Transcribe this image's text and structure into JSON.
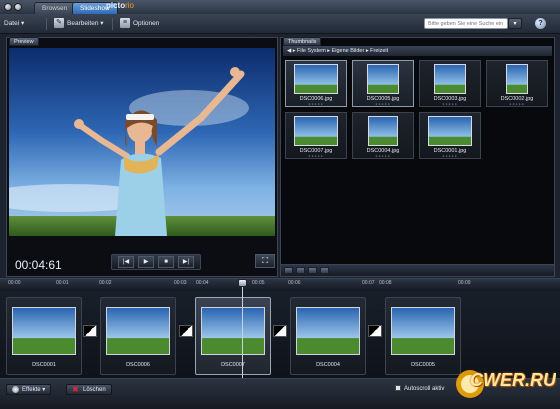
{
  "app": {
    "tabs": [
      {
        "label": "Browsen",
        "active": false
      },
      {
        "label": "Slideshow",
        "active": true
      }
    ],
    "brand": "picto",
    "brand_suffix": "rio"
  },
  "toolbar": {
    "file_label": "Datei",
    "edit_label": "Bearbeiten",
    "options_label": "Optionen",
    "search_placeholder": "Bitte geben Sie eine Suche ein",
    "help_label": "?"
  },
  "preview": {
    "tab_label": "Preview",
    "timecode": "00:04:61",
    "controls": [
      "prev-icon",
      "play-icon",
      "stop-icon",
      "next-icon"
    ]
  },
  "thumbnails": {
    "tab_label": "Thumbnails",
    "breadcrumb": [
      "File System",
      "Eigene Bilder",
      "Freizeit"
    ],
    "items": [
      {
        "label": "DSC0006.jpg",
        "selected": true
      },
      {
        "label": "DSC0005.jpg",
        "selected": true
      },
      {
        "label": "DSC0003.jpg",
        "selected": false
      },
      {
        "label": "DSC0002.jpg",
        "selected": false
      },
      {
        "label": "DSC0007.jpg",
        "selected": false
      },
      {
        "label": "DSC0004.jpg",
        "selected": false
      },
      {
        "label": "DSC0001.jpg",
        "selected": false
      }
    ]
  },
  "timeline": {
    "ruler_ticks": [
      "00:00",
      "00:01",
      "00:02",
      "00:03",
      "00:04",
      "00:05",
      "00:06",
      "00:07",
      "00:08",
      "00:09"
    ],
    "clips": [
      {
        "label": "DSC0001",
        "selected": false
      },
      {
        "label": "DSC0006",
        "selected": false
      },
      {
        "label": "DSC0007",
        "selected": true
      },
      {
        "label": "DSC0004",
        "selected": false
      },
      {
        "label": "DSC0005",
        "selected": false
      }
    ]
  },
  "statusbar": {
    "effects_label": "Effekte",
    "delete_label": "Löschen",
    "autoscroll_label": "Autoscroll aktiv",
    "watermark": "CWER.RU"
  },
  "colors": {
    "accent": "#2d6bb8",
    "background": "#1d2430"
  }
}
